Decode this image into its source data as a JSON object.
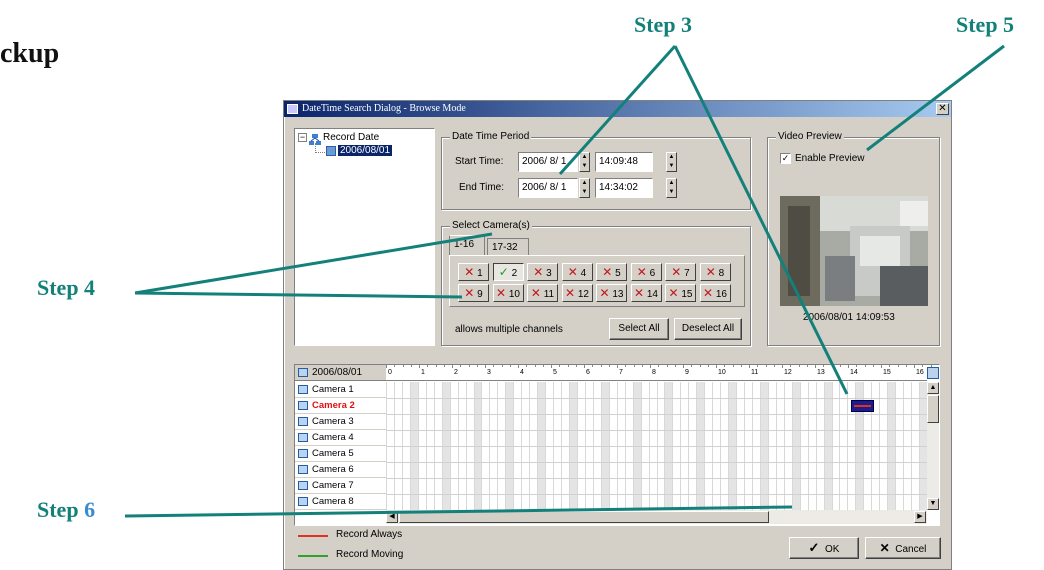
{
  "page": {
    "heading": "ckup",
    "steps": {
      "step3": "Step 3",
      "step4": "Step 4",
      "step5": "Step 5",
      "step6_word": "Step",
      "step6_num": "6"
    }
  },
  "dialog": {
    "title": "DateTime Search Dialog - Browse Mode",
    "close_label": "✕",
    "tree": {
      "root_label": "Record Date",
      "child_label": "2006/08/01"
    },
    "period": {
      "group_label": "Date Time Period",
      "start_label": "Start Time:",
      "start_date": "2006/ 8/ 1",
      "start_time": "14:09:48",
      "end_label": "End Time:",
      "end_date": "2006/ 8/ 1",
      "end_time": "14:34:02"
    },
    "cameras": {
      "group_label": "Select Camera(s)",
      "tabs": [
        "1-16",
        "17-32"
      ],
      "buttons": [
        {
          "num": "1",
          "mark": "✕",
          "on": false
        },
        {
          "num": "2",
          "mark": "✓",
          "on": true
        },
        {
          "num": "3",
          "mark": "✕",
          "on": false
        },
        {
          "num": "4",
          "mark": "✕",
          "on": false
        },
        {
          "num": "5",
          "mark": "✕",
          "on": false
        },
        {
          "num": "6",
          "mark": "✕",
          "on": false
        },
        {
          "num": "7",
          "mark": "✕",
          "on": false
        },
        {
          "num": "8",
          "mark": "✕",
          "on": false
        },
        {
          "num": "9",
          "mark": "✕",
          "on": false
        },
        {
          "num": "10",
          "mark": "✕",
          "on": false
        },
        {
          "num": "11",
          "mark": "✕",
          "on": false
        },
        {
          "num": "12",
          "mark": "✕",
          "on": false
        },
        {
          "num": "13",
          "mark": "✕",
          "on": false
        },
        {
          "num": "14",
          "mark": "✕",
          "on": false
        },
        {
          "num": "15",
          "mark": "✕",
          "on": false
        },
        {
          "num": "16",
          "mark": "✕",
          "on": false
        }
      ],
      "hint": "allows multiple channels",
      "select_all": "Select All",
      "deselect_all": "Deselect All"
    },
    "preview": {
      "group_label": "Video Preview",
      "enable_label": "Enable Preview",
      "enable_checked": true,
      "timestamp": "2006/08/01 14:09:53"
    },
    "timeline": {
      "date": "2006/08/01",
      "hours": [
        "0",
        "1",
        "2",
        "3",
        "4",
        "5",
        "6",
        "7",
        "8",
        "9",
        "10",
        "11",
        "12",
        "13",
        "14",
        "15",
        "16"
      ],
      "cameras": [
        "Camera 1",
        "Camera 2",
        "Camera 3",
        "Camera 4",
        "Camera 5",
        "Camera 6",
        "Camera 7",
        "Camera 8"
      ],
      "selected_camera": "Camera 2"
    },
    "legend": {
      "always": "Record Always",
      "always_color": "#e03020",
      "moving": "Record Moving",
      "moving_color": "#30a030"
    },
    "ok_label": "OK",
    "cancel_label": "Cancel"
  }
}
